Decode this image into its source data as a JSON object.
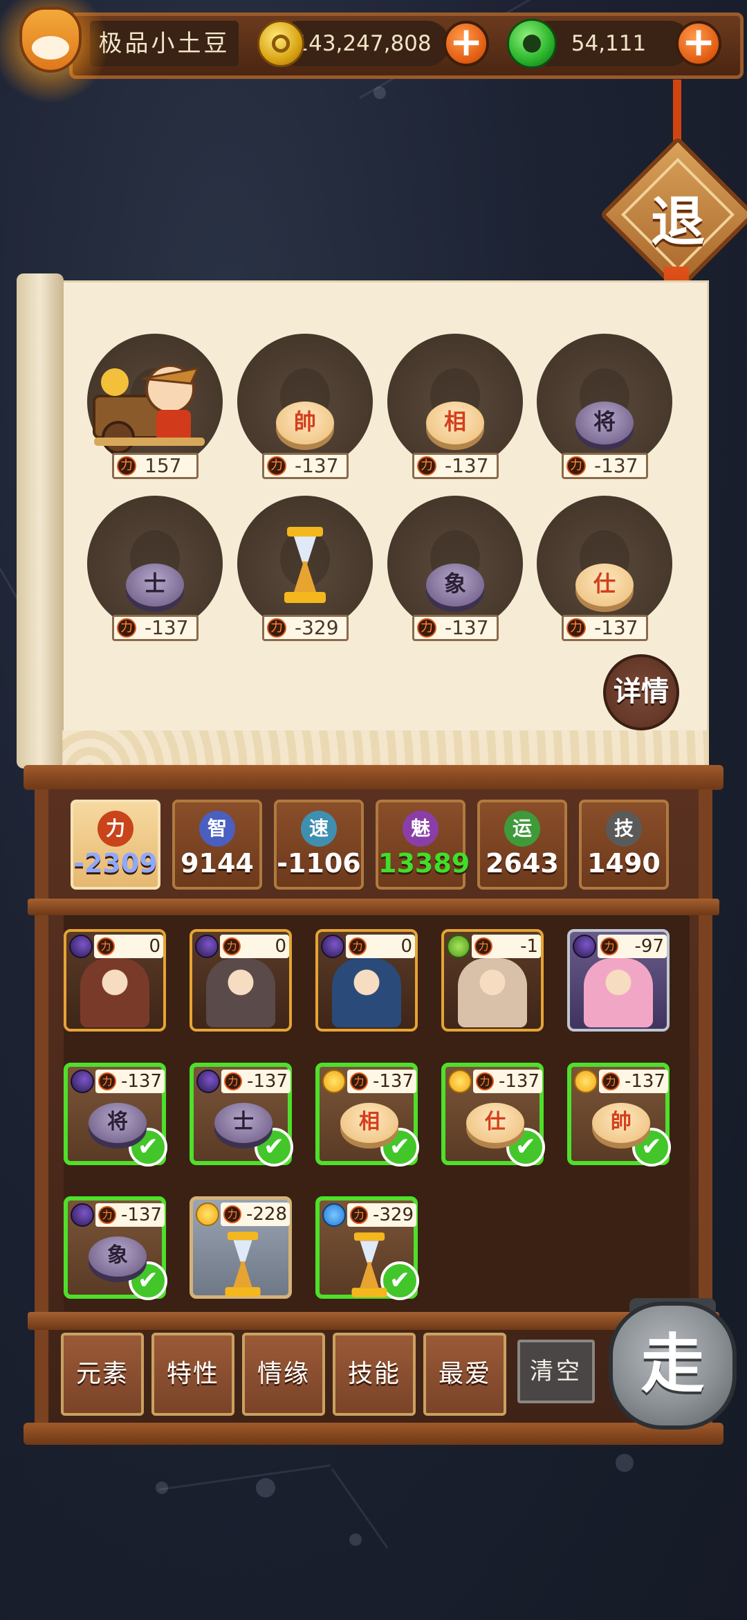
{
  "player": {
    "name": "极品小土豆"
  },
  "currency": {
    "gold": "143,247,808",
    "jade": "54,111",
    "plus": "+"
  },
  "exit_label": "退",
  "detail_label": "详情",
  "go_label": "走",
  "clear_label": "清空",
  "slots": [
    {
      "kind": "hero",
      "cost": "157"
    },
    {
      "kind": "piece",
      "tone": "light",
      "char": "帥",
      "cost": "-137"
    },
    {
      "kind": "piece",
      "tone": "light",
      "char": "相",
      "cost": "-137"
    },
    {
      "kind": "piece",
      "tone": "dark",
      "char": "将",
      "cost": "-137"
    },
    {
      "kind": "piece",
      "tone": "dark",
      "char": "士",
      "cost": "-137"
    },
    {
      "kind": "hourglass",
      "cost": "-329"
    },
    {
      "kind": "piece",
      "tone": "dark",
      "char": "象",
      "cost": "-137"
    },
    {
      "kind": "piece",
      "tone": "light",
      "char": "仕",
      "cost": "-137"
    }
  ],
  "stats": [
    {
      "icon": "力",
      "value": "-2309",
      "color": "#8fa8ff",
      "orb": "#c9441a",
      "active": true
    },
    {
      "icon": "智",
      "value": "9144",
      "color": "#ffffff",
      "orb": "#4a5fbf",
      "active": false
    },
    {
      "icon": "速",
      "value": "-1106",
      "color": "#ffffff",
      "orb": "#3f8fb0",
      "active": false
    },
    {
      "icon": "魅",
      "value": "13389",
      "color": "#3ee02a",
      "orb": "#8a3fa8",
      "active": false
    },
    {
      "icon": "运",
      "value": "2643",
      "color": "#ffffff",
      "orb": "#3f9a3a",
      "active": false
    },
    {
      "icon": "技",
      "value": "1490",
      "color": "#ffffff",
      "orb": "#5a5a5a",
      "active": false
    }
  ],
  "cards": [
    {
      "type": "hero",
      "elem": "moon",
      "cost": "0",
      "tint": "#7a3a2a"
    },
    {
      "type": "hero",
      "elem": "moon",
      "cost": "0",
      "tint": "#5a4a4a"
    },
    {
      "type": "hero",
      "elem": "moon",
      "cost": "0",
      "tint": "#2a4a7a"
    },
    {
      "type": "hero",
      "elem": "leaf",
      "cost": "-1",
      "tint": "#d9c0a8"
    },
    {
      "type": "hero-silver",
      "elem": "moon",
      "cost": "-97",
      "tint": "#f2a6c6"
    },
    {
      "type": "sel",
      "elem": "moon",
      "cost": "-137",
      "tone": "dark",
      "char": "将"
    },
    {
      "type": "sel",
      "elem": "moon",
      "cost": "-137",
      "tone": "dark",
      "char": "士"
    },
    {
      "type": "sel",
      "elem": "sun",
      "cost": "-137",
      "tone": "light",
      "char": "相"
    },
    {
      "type": "sel",
      "elem": "sun",
      "cost": "-137",
      "tone": "light",
      "char": "仕"
    },
    {
      "type": "sel",
      "elem": "sun",
      "cost": "-137",
      "tone": "light",
      "char": "帥"
    },
    {
      "type": "sel",
      "elem": "moon",
      "cost": "-137",
      "tone": "dark",
      "char": "象"
    },
    {
      "type": "plain-hourglass",
      "elem": "sun",
      "cost": "-228"
    },
    {
      "type": "sel-hourglass",
      "elem": "water",
      "cost": "-329"
    }
  ],
  "tabs": [
    "元素",
    "特性",
    "情缘",
    "技能",
    "最爱"
  ],
  "icon_power": "力",
  "check_mark": "✔"
}
